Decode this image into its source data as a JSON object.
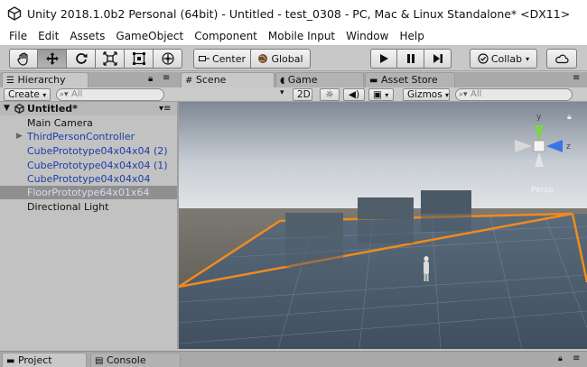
{
  "window": {
    "title": "Unity 2018.1.0b2 Personal (64bit) - Untitled - test_0308 - PC, Mac & Linux Standalone* <DX11>"
  },
  "menu": [
    "File",
    "Edit",
    "Assets",
    "GameObject",
    "Component",
    "Mobile Input",
    "Window",
    "Help"
  ],
  "toolbar": {
    "tools": [
      "hand-tool-icon",
      "move-tool-icon",
      "rotate-tool-icon",
      "scale-tool-icon",
      "rect-tool-icon",
      "transform-tool-icon"
    ],
    "pivot_label": "Center",
    "space_label": "Global",
    "collab_label": "Collab"
  },
  "hierarchy": {
    "tab_label": "Hierarchy",
    "create_label": "Create",
    "search_placeholder": "All",
    "scene_name": "Untitled*",
    "items": [
      {
        "label": "Main Camera",
        "style": "normal",
        "foldout": false
      },
      {
        "label": "ThirdPersonController",
        "style": "blue",
        "foldout": true
      },
      {
        "label": "CubePrototype04x04x04 (2)",
        "style": "blue",
        "foldout": false
      },
      {
        "label": "CubePrototype04x04x04 (1)",
        "style": "blue",
        "foldout": false
      },
      {
        "label": "CubePrototype04x04x04",
        "style": "blue",
        "foldout": false
      },
      {
        "label": "FloorPrototype64x01x64",
        "style": "selected",
        "foldout": false
      },
      {
        "label": "Directional Light",
        "style": "normal",
        "foldout": false
      }
    ]
  },
  "scene": {
    "tabs": [
      {
        "label": "Scene",
        "icon": "grid-icon",
        "active": true
      },
      {
        "label": "Game",
        "icon": "pacman-icon",
        "active": false
      },
      {
        "label": "Asset Store",
        "icon": "store-icon",
        "active": false
      }
    ],
    "mode_2d_label": "2D",
    "gizmos_label": "Gizmos",
    "search_placeholder": "All",
    "gizmo": {
      "y_label": "y",
      "z_label": "z",
      "persp_label": "Persp"
    }
  },
  "bottom": {
    "tabs": [
      {
        "label": "Project",
        "icon": "folder-icon"
      },
      {
        "label": "Console",
        "icon": "console-icon"
      }
    ]
  },
  "colors": {
    "selection_outline": "#f28a1e",
    "gizmo_y": "#7fd34a",
    "gizmo_z": "#3b74e8",
    "gizmo_x": "#d8d8d8",
    "hierarchy_prefab_text": "#1e3ea6"
  }
}
